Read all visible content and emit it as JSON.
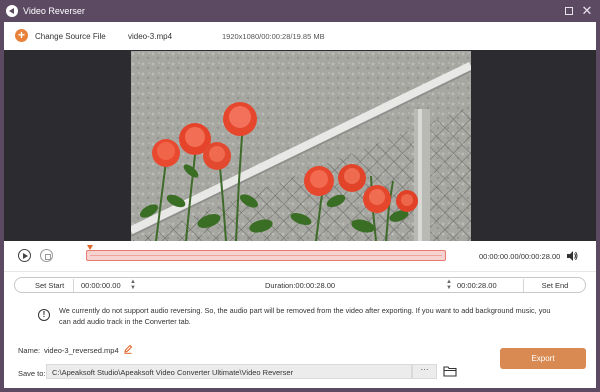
{
  "window": {
    "title": "Video Reverser",
    "maximize_icon": "maximize-icon",
    "close_glyph": "✕"
  },
  "toolbar": {
    "change_source_label": "Change Source File",
    "add_icon_glyph": "+",
    "file_name": "video-3.mp4",
    "file_info": "1920x1080/00:00:28/19.85 MB"
  },
  "player": {
    "time_display": "00:00:00.00/00:00:28.00",
    "play_icon": "play-icon",
    "stop_icon": "stop-icon",
    "volume_icon": "volume-icon"
  },
  "range": {
    "set_start_label": "Set Start",
    "start_time": "00:00:00.00",
    "duration": "Duration:00:00:28.00",
    "end_time": "00:00:28.00",
    "set_end_label": "Set End"
  },
  "notice": {
    "icon_glyph": "!",
    "text": "We currently do not support audio reversing. So, the audio part will be removed from the video after exporting. If you want to add background music, you can add audio track in the Converter tab."
  },
  "output": {
    "name_label": "Name:",
    "name_value": "video-3_reversed.mp4",
    "save_to_label": "Save to:",
    "save_path": "C:\\Apeaksoft Studio\\Apeaksoft Video Converter Ultimate\\Video Reverser",
    "more_label": "···",
    "export_label": "Export"
  },
  "colors": {
    "title_bar": "#5c4a63",
    "accent": "#e8823a",
    "export_button": "#d98a52",
    "timeline_fill": "#f6d3d0",
    "timeline_border": "#e77a70"
  }
}
